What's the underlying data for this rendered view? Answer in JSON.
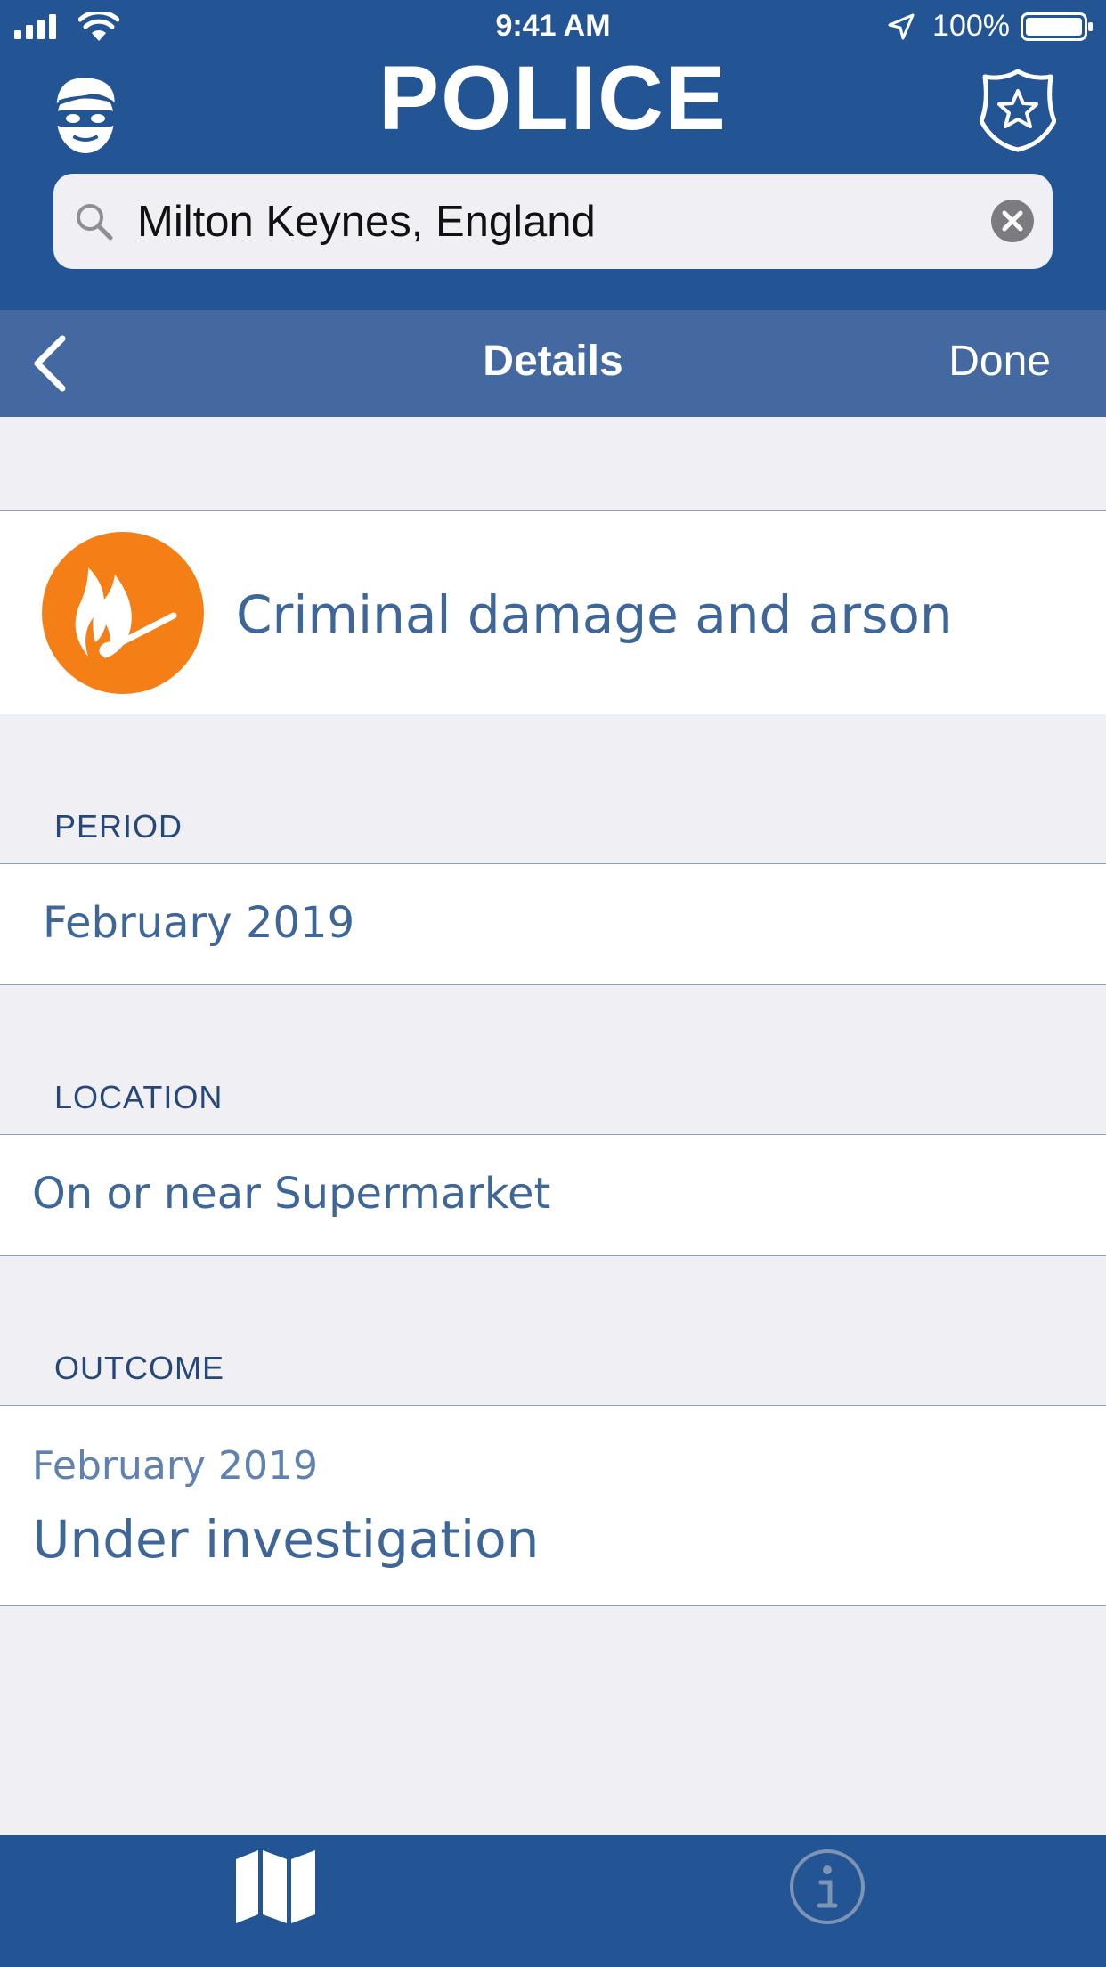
{
  "status_bar": {
    "time": "9:41 AM",
    "battery_percent": "100%",
    "icons": [
      "signal-icon",
      "wifi-icon",
      "location-arrow-icon",
      "battery-icon"
    ]
  },
  "header": {
    "title": "POLICE",
    "left_icon": "robber-mask-icon",
    "right_icon": "police-badge-icon",
    "background_color": "#235595"
  },
  "search": {
    "value": "Milton Keynes, England",
    "icon": "search-icon",
    "clear_icon": "clear-icon"
  },
  "navbar": {
    "title": "Details",
    "done_label": "Done",
    "back_icon": "chevron-left-icon",
    "background_color": "#4369a0"
  },
  "crime": {
    "category": "Criminal damage and arson",
    "icon": "burning-match-icon",
    "icon_color": "#f57f17"
  },
  "period": {
    "header": "PERIOD",
    "value": "February 2019"
  },
  "location": {
    "header": "LOCATION",
    "value": "On or near Supermarket"
  },
  "outcome": {
    "header": "OUTCOME",
    "date": "February 2019",
    "status": "Under investigation"
  },
  "tabbar": {
    "tabs": [
      {
        "name": "map",
        "icon": "map-icon",
        "selected": true
      },
      {
        "name": "info",
        "icon": "info-icon",
        "selected": false
      }
    ]
  }
}
